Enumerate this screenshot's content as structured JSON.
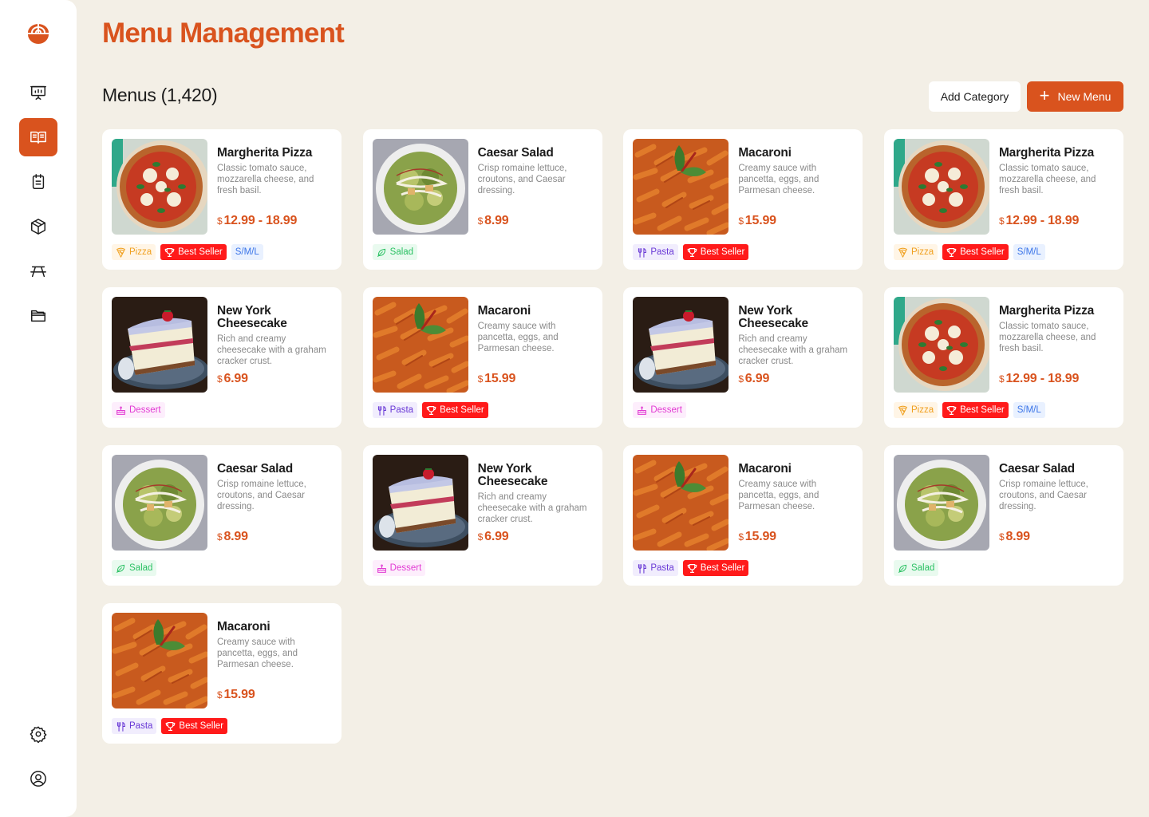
{
  "app": {
    "page_title": "Menu Management",
    "section_title": "Menus (1,420)",
    "accent": "#d9531e"
  },
  "sidebar": {
    "items": [
      {
        "name": "dashboard",
        "icon": "presentation-chart-icon",
        "active": false
      },
      {
        "name": "menu",
        "icon": "open-book-icon",
        "active": true
      },
      {
        "name": "orders",
        "icon": "clipboard-icon",
        "active": false
      },
      {
        "name": "inventory",
        "icon": "box-icon",
        "active": false
      },
      {
        "name": "tables",
        "icon": "picnic-table-icon",
        "active": false
      },
      {
        "name": "files",
        "icon": "folder-icon",
        "active": false
      }
    ],
    "bottom": [
      {
        "name": "settings",
        "icon": "gear-icon"
      },
      {
        "name": "profile",
        "icon": "user-circle-icon"
      }
    ]
  },
  "actions": {
    "add_category": "Add Category",
    "new_menu": "New Menu"
  },
  "tags": {
    "pizza": "Pizza",
    "salad": "Salad",
    "pasta": "Pasta",
    "dessert": "Dessert",
    "best": "Best Seller",
    "size": "S/M/L"
  },
  "menus": [
    {
      "name": "Margherita Pizza",
      "desc": "Classic tomato sauce, mozzarella cheese, and fresh basil.",
      "currency": "$",
      "price": "12.99 - 18.99",
      "image": "pizza",
      "tags": [
        "pizza",
        "best",
        "size"
      ]
    },
    {
      "name": "Caesar Salad",
      "desc": "Crisp romaine lettuce, croutons, and Caesar dressing.",
      "currency": "$",
      "price": "8.99",
      "image": "salad",
      "tags": [
        "salad"
      ]
    },
    {
      "name": "Macaroni",
      "desc": "Creamy sauce with pancetta, eggs, and Parmesan cheese.",
      "currency": "$",
      "price": "15.99",
      "image": "pasta",
      "tags": [
        "pasta",
        "best"
      ]
    },
    {
      "name": "Margherita Pizza",
      "desc": "Classic tomato sauce, mozzarella cheese, and fresh basil.",
      "currency": "$",
      "price": "12.99 - 18.99",
      "image": "pizza",
      "tags": [
        "pizza",
        "best",
        "size"
      ]
    },
    {
      "name": "New York Cheesecake",
      "desc": "Rich and creamy cheesecake with a graham cracker crust.",
      "currency": "$",
      "price": "6.99",
      "image": "cake",
      "tags": [
        "dessert"
      ]
    },
    {
      "name": "Macaroni",
      "desc": "Creamy sauce with pancetta, eggs, and Parmesan cheese.",
      "currency": "$",
      "price": "15.99",
      "image": "pasta",
      "tags": [
        "pasta",
        "best"
      ]
    },
    {
      "name": "New York Cheesecake",
      "desc": "Rich and creamy cheesecake with a graham cracker crust.",
      "currency": "$",
      "price": "6.99",
      "image": "cake",
      "tags": [
        "dessert"
      ]
    },
    {
      "name": "Margherita Pizza",
      "desc": "Classic tomato sauce, mozzarella cheese, and fresh basil.",
      "currency": "$",
      "price": "12.99 - 18.99",
      "image": "pizza",
      "tags": [
        "pizza",
        "best",
        "size"
      ]
    },
    {
      "name": "Caesar Salad",
      "desc": "Crisp romaine lettuce, croutons, and Caesar dressing.",
      "currency": "$",
      "price": "8.99",
      "image": "salad",
      "tags": [
        "salad"
      ]
    },
    {
      "name": "New York Cheesecake",
      "desc": "Rich and creamy cheesecake with a graham cracker crust.",
      "currency": "$",
      "price": "6.99",
      "image": "cake",
      "tags": [
        "dessert"
      ]
    },
    {
      "name": "Macaroni",
      "desc": "Creamy sauce with pancetta, eggs, and Parmesan cheese.",
      "currency": "$",
      "price": "15.99",
      "image": "pasta",
      "tags": [
        "pasta",
        "best"
      ]
    },
    {
      "name": "Caesar Salad",
      "desc": "Crisp romaine lettuce, croutons, and Caesar dressing.",
      "currency": "$",
      "price": "8.99",
      "image": "salad",
      "tags": [
        "salad"
      ]
    },
    {
      "name": "Macaroni",
      "desc": "Creamy sauce with pancetta, eggs, and Parmesan cheese.",
      "currency": "$",
      "price": "15.99",
      "image": "pasta",
      "tags": [
        "pasta",
        "best"
      ]
    }
  ]
}
